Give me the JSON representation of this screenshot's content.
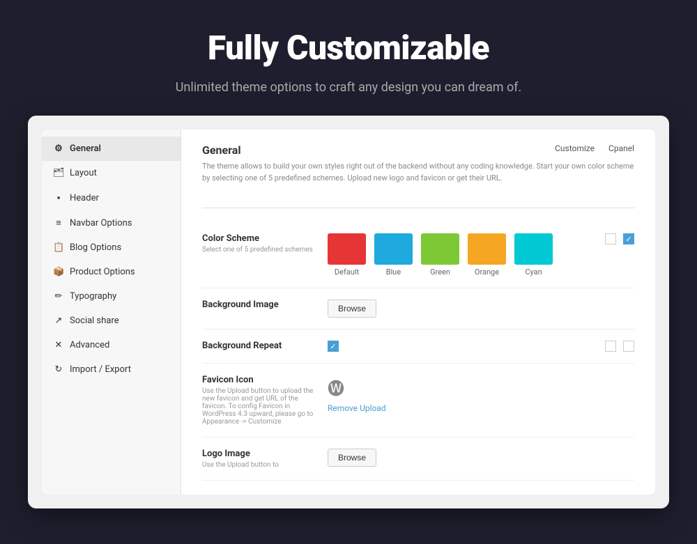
{
  "hero": {
    "title": "Fully Customizable",
    "subtitle": "Unlimited theme options to craft any design you can dream of."
  },
  "sidebar": {
    "items": [
      {
        "id": "general",
        "label": "General",
        "icon": "⚙",
        "active": true
      },
      {
        "id": "layout",
        "label": "Layout",
        "icon": "🗂",
        "active": false
      },
      {
        "id": "header",
        "label": "Header",
        "icon": "▪",
        "active": false
      },
      {
        "id": "navbar",
        "label": "Navbar Options",
        "icon": "≡",
        "active": false
      },
      {
        "id": "blog",
        "label": "Blog Options",
        "icon": "📋",
        "active": false
      },
      {
        "id": "product",
        "label": "Product Options",
        "icon": "📦",
        "active": false
      },
      {
        "id": "typography",
        "label": "Typography",
        "icon": "✏",
        "active": false
      },
      {
        "id": "social",
        "label": "Social share",
        "icon": "↗",
        "active": false
      },
      {
        "id": "advanced",
        "label": "Advanced",
        "icon": "✕",
        "active": false
      },
      {
        "id": "import",
        "label": "Import / Export",
        "icon": "↻",
        "active": false
      }
    ]
  },
  "main": {
    "section_title": "General",
    "section_description": "The theme allows to build your own styles right out of the backend without any coding knowledge. Start your own color scheme by selecting one of 5 predefined schemes. Upload new logo and favicon or get their URL.",
    "top_links": {
      "customize": "Customize",
      "cpanel": "Cpanel"
    },
    "options": [
      {
        "id": "color-scheme",
        "label": "Color Scheme",
        "sublabel": "Select one of 5 predefined schemes",
        "type": "color-swatches",
        "swatches": [
          {
            "color": "#e63535",
            "name": "Default"
          },
          {
            "color": "#1eaadc",
            "name": "Blue"
          },
          {
            "color": "#7dc935",
            "name": "Green"
          },
          {
            "color": "#f5a623",
            "name": "Orange"
          },
          {
            "color": "#00c9d4",
            "name": "Cyan"
          }
        ],
        "checkbox1_checked": false,
        "checkbox2_checked": true
      },
      {
        "id": "background-image",
        "label": "Background Image",
        "type": "browse",
        "button_label": "Browse"
      },
      {
        "id": "background-repeat",
        "label": "Background Repeat",
        "type": "checkbox-row",
        "checkbox1_checked": true,
        "checkbox2_checked": false,
        "checkbox3_checked": false
      },
      {
        "id": "favicon-icon",
        "label": "Favicon Icon",
        "description": "Use the Upload button to upload the new favicon and get URL of the favicon. To config Favicon in WordPress 4.3 upward, please go to Appearance -> Customize",
        "type": "favicon",
        "remove_label": "Remove Upload",
        "wp_icon": "⊞"
      },
      {
        "id": "logo-image",
        "label": "Logo Image",
        "description": "Use the Upload button to",
        "type": "logo-browse",
        "button_label": "Browse"
      }
    ]
  }
}
